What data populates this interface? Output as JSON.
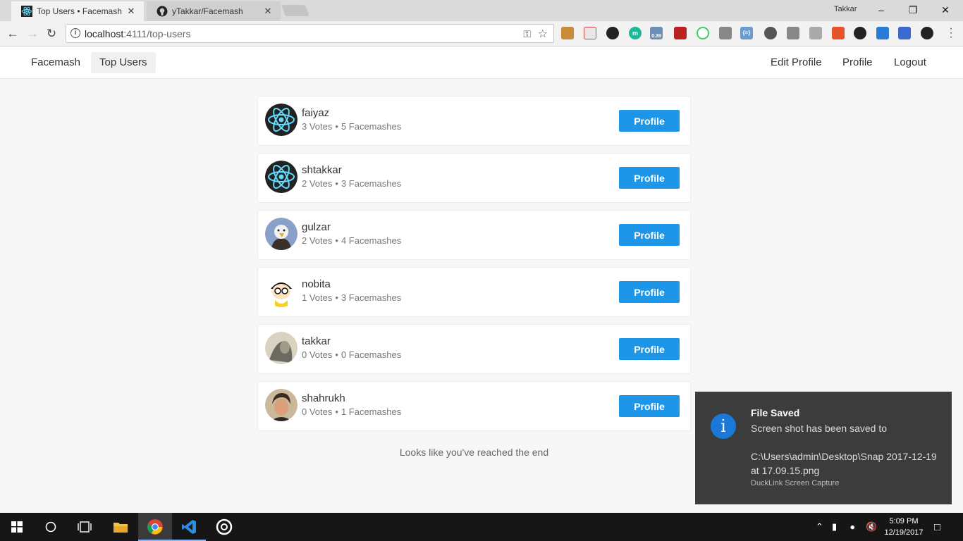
{
  "browser": {
    "tabs": [
      {
        "title": "Top Users • Facemash",
        "active": true
      },
      {
        "title": "yTakkar/Facemash",
        "active": false
      }
    ],
    "profile_name": "Takkar",
    "url_host": "localhost",
    "url_rest": ":4111/top-users",
    "extension_badge": "0.39"
  },
  "navbar": {
    "brand": "Facemash",
    "top_users": "Top Users",
    "edit_profile": "Edit Profile",
    "profile": "Profile",
    "logout": "Logout"
  },
  "users": [
    {
      "name": "faiyaz",
      "votes": "3 Votes",
      "facemashes": "5 Facemashes",
      "avatar": "react-logo",
      "button": "Profile"
    },
    {
      "name": "shtakkar",
      "votes": "2 Votes",
      "facemashes": "3 Facemashes",
      "avatar": "react-logo",
      "button": "Profile"
    },
    {
      "name": "gulzar",
      "votes": "2 Votes",
      "facemashes": "4 Facemashes",
      "avatar": "eagle-photo",
      "button": "Profile"
    },
    {
      "name": "nobita",
      "votes": "1 Votes",
      "facemashes": "3 Facemashes",
      "avatar": "cartoon-boy",
      "button": "Profile"
    },
    {
      "name": "takkar",
      "votes": "0 Votes",
      "facemashes": "0 Facemashes",
      "avatar": "person-photo",
      "button": "Profile"
    },
    {
      "name": "shahrukh",
      "votes": "0 Votes",
      "facemashes": "1 Facemashes",
      "avatar": "person-photo",
      "button": "Profile"
    }
  ],
  "separator": "•",
  "end_message": "Looks like you've reached the end",
  "notification": {
    "title": "File Saved",
    "body": "Screen shot has been saved to",
    "path": "C:\\Users\\admin\\Desktop\\Snap 2017-12-19 at 17.09.15.png",
    "app": "DuckLink Screen Capture"
  },
  "taskbar": {
    "time": "5:09 PM",
    "date": "12/19/2017"
  },
  "colors": {
    "accent": "#1e96e8",
    "toast_bg": "#3c3c3c",
    "info_icon": "#1a78d8"
  }
}
